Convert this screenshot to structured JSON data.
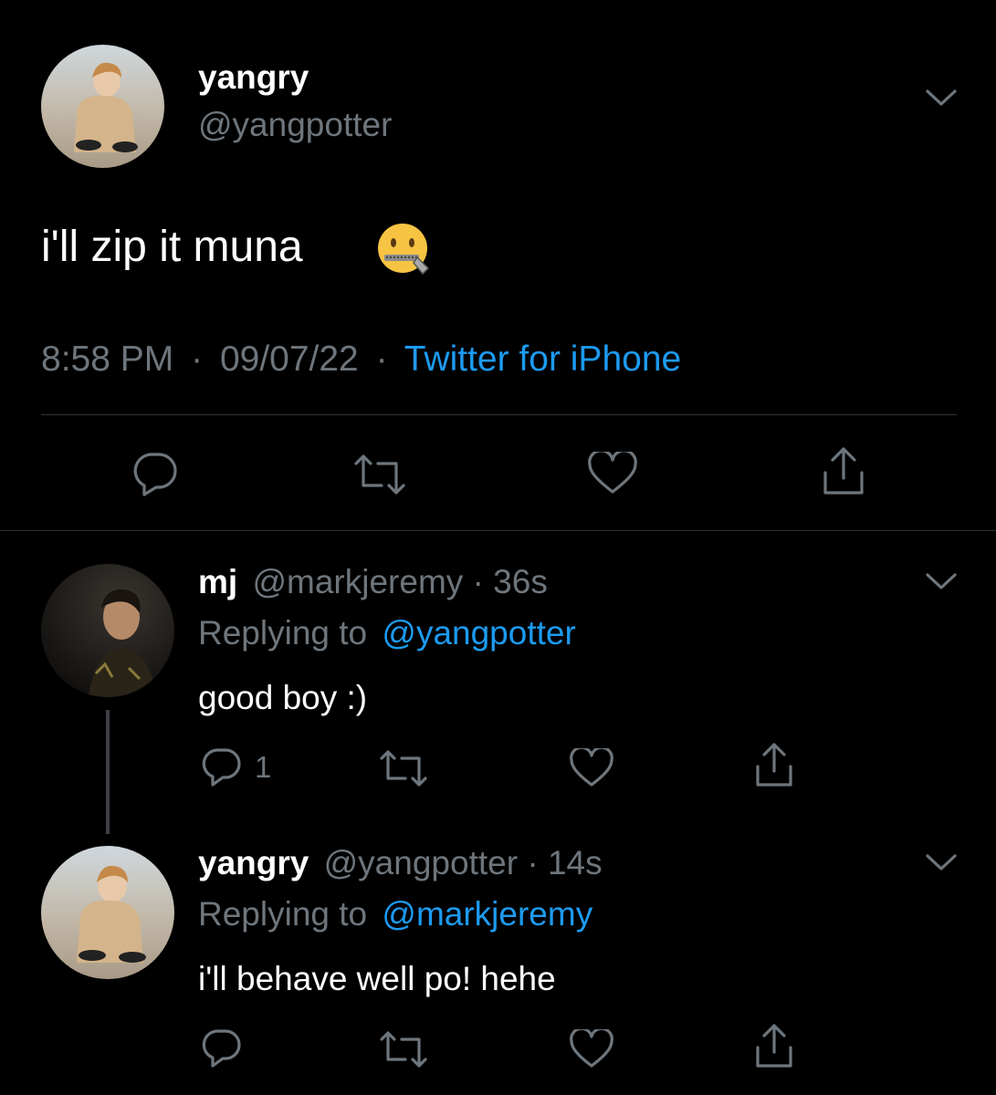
{
  "main_tweet": {
    "display_name": "yangry",
    "handle": "@yangpotter",
    "text": "i'll zip it muna",
    "emoji_icon": "zipper-mouth-face",
    "time": "8:58 PM",
    "date": "09/07/22",
    "source": "Twitter for iPhone",
    "separator": "·"
  },
  "replies": [
    {
      "display_name": "mj",
      "handle": "@markjeremy",
      "time_ago": "36s",
      "replying_label": "Replying to",
      "replying_to": "@yangpotter",
      "text": "good boy :)",
      "reply_count": "1"
    },
    {
      "display_name": "yangry",
      "handle": "@yangpotter",
      "time_ago": "14s",
      "replying_label": "Replying to",
      "replying_to": "@markjeremy",
      "text": "i'll behave well po! hehe"
    }
  ],
  "colors": {
    "background": "#000000",
    "muted": "#6e767d",
    "link": "#1d9bf0",
    "divider": "#2f3336"
  }
}
